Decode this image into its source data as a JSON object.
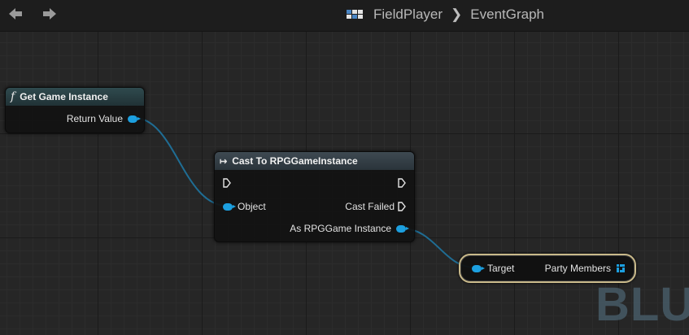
{
  "toolbar": {
    "back_icon": "arrow-left-icon",
    "forward_icon": "arrow-right-icon",
    "blueprint_icon": "blueprint-grid-icon",
    "breadcrumb": [
      "FieldPlayer",
      "EventGraph"
    ]
  },
  "graph": {
    "watermark": "BLUE"
  },
  "nodes": {
    "get_game_instance": {
      "title": "Get Game Instance",
      "pins": {
        "return_value": "Return Value"
      }
    },
    "cast": {
      "title": "Cast To RPGGameInstance",
      "pins": {
        "object": "Object",
        "cast_failed": "Cast Failed",
        "as_instance": "As RPGGame Instance"
      }
    },
    "get_party": {
      "pins": {
        "target": "Target",
        "party_members": "Party Members"
      }
    }
  },
  "colors": {
    "object_pin": "#1c9fdf",
    "wire": "#1f6d94",
    "get_node_border": "#c9b98a",
    "header_function": "#2f4a4e",
    "header_cast": "#3e4a52"
  }
}
